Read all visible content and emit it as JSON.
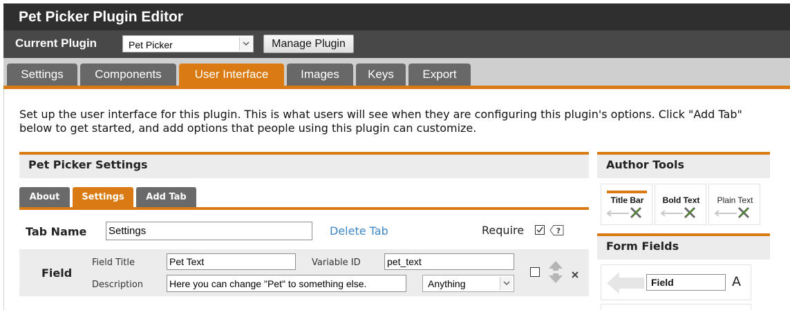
{
  "app": {
    "title": "Pet Picker Plugin Editor"
  },
  "plugin_bar": {
    "label": "Current Plugin",
    "selected_plugin": "Pet Picker",
    "manage_button": "Manage Plugin"
  },
  "main_tabs": [
    {
      "label": "Settings",
      "active": false
    },
    {
      "label": "Components",
      "active": false
    },
    {
      "label": "User Interface",
      "active": true
    },
    {
      "label": "Images",
      "active": false
    },
    {
      "label": "Keys",
      "active": false
    },
    {
      "label": "Export",
      "active": false
    }
  ],
  "intro_text": "Set up the user interface for this plugin. This is what users will see when they are configuring this plugin's options. Click \"Add Tab\" below to get started, and add options that people using this plugin can customize.",
  "settings_panel": {
    "title": "Pet Picker Settings",
    "tabs": [
      {
        "label": "About",
        "active": false
      },
      {
        "label": "Settings",
        "active": true
      },
      {
        "label": "Add Tab",
        "active": false
      }
    ],
    "tab_name_label": "Tab Name",
    "tab_name_value": "Settings",
    "delete_tab": "Delete Tab",
    "require_label": "Require",
    "require_checked": true,
    "field": {
      "label": "Field",
      "title_label": "Field Title",
      "title_value": "Pet Text",
      "variable_label": "Variable ID",
      "variable_value": "pet_text",
      "description_label": "Description",
      "description_value": "Here you can change \"Pet\" to something else.",
      "type_value": "Anything",
      "checked": false
    }
  },
  "author_tools": {
    "title": "Author Tools",
    "tools": [
      {
        "label": "Title Bar"
      },
      {
        "label": "Bold Text"
      },
      {
        "label": "Plain Text"
      }
    ]
  },
  "form_fields": {
    "title": "Form Fields",
    "items": [
      {
        "label": "Field",
        "glyph": "A"
      }
    ]
  },
  "colors": {
    "accent": "#d97b12",
    "title_bar": "#2f2f2f",
    "plugin_bar": "#484848",
    "tab_inactive": "#686868",
    "link": "#3d86c6"
  }
}
